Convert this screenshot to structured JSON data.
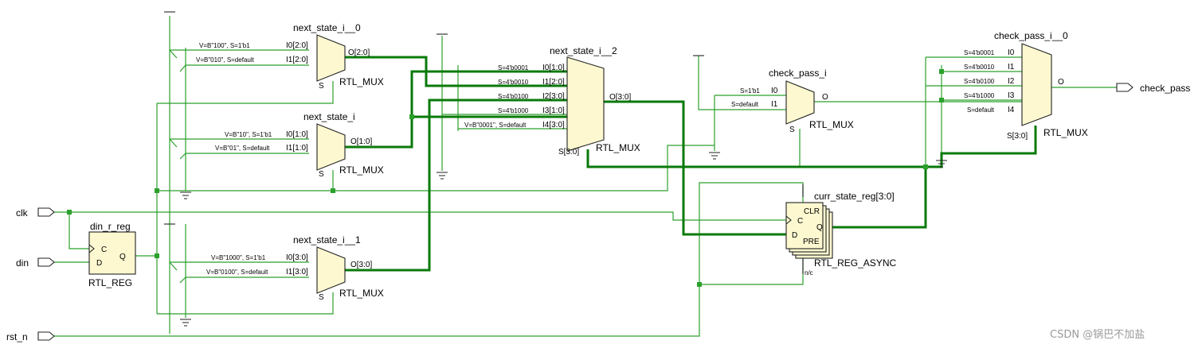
{
  "ports": {
    "clk": "clk",
    "din": "din",
    "rst_n": "rst_n",
    "check_pass": "check_pass"
  },
  "din_r_reg": {
    "name": "din_r_reg",
    "type": "RTL_REG",
    "pin_c": "C",
    "pin_d": "D",
    "pin_q": "Q"
  },
  "next_state_i__0": {
    "name": "next_state_i__0",
    "type": "RTL_MUX",
    "in0_const": "V=B\"100\", S=1'b1",
    "in0_pin": "I0[2:0]",
    "in1_const": "V=B\"010\", S=default",
    "in1_pin": "I1[2:0]",
    "out_pin": "O[2:0]",
    "sel_pin": "S"
  },
  "next_state_i": {
    "name": "next_state_i",
    "type": "RTL_MUX",
    "in0_const": "V=B\"10\", S=1'b1",
    "in0_pin": "I0[1:0]",
    "in1_const": "V=B\"01\", S=default",
    "in1_pin": "I1[1:0]",
    "out_pin": "O[1:0]",
    "sel_pin": "S"
  },
  "next_state_i__1": {
    "name": "next_state_i__1",
    "type": "RTL_MUX",
    "in0_const": "V=B\"1000\", S=1'b1",
    "in0_pin": "I0[3:0]",
    "in1_const": "V=B\"0100\", S=default",
    "in1_pin": "I1[3:0]",
    "out_pin": "O[3:0]",
    "sel_pin": "S"
  },
  "next_state_i__2": {
    "name": "next_state_i__2",
    "type": "RTL_MUX",
    "inputs": [
      {
        "cond": "S=4'b0001",
        "pin": "I0[1:0]"
      },
      {
        "cond": "S=4'b0010",
        "pin": "I1[2:0]"
      },
      {
        "cond": "S=4'b0100",
        "pin": "I2[3:0]"
      },
      {
        "cond": "S=4'b1000",
        "pin": "I3[1:0]"
      },
      {
        "cond": "V=B\"0001\", S=default",
        "pin": "I4[3:0]"
      }
    ],
    "out_pin": "O[3:0]",
    "sel_pin": "S[3:0]"
  },
  "check_pass_i": {
    "name": "check_pass_i",
    "type": "RTL_MUX",
    "inputs": [
      {
        "cond": "S=1'b1",
        "pin": "I0"
      },
      {
        "cond": "S=default",
        "pin": "I1"
      }
    ],
    "out_pin": "O",
    "sel_pin": "S"
  },
  "check_pass_i__0": {
    "name": "check_pass_i__0",
    "type": "RTL_MUX",
    "inputs": [
      {
        "cond": "S=4'b0001",
        "pin": "I0"
      },
      {
        "cond": "S=4'b0010",
        "pin": "I1"
      },
      {
        "cond": "S=4'b0100",
        "pin": "I2"
      },
      {
        "cond": "S=4'b1000",
        "pin": "I3"
      },
      {
        "cond": "S=default",
        "pin": "I4"
      }
    ],
    "out_pin": "O",
    "sel_pin": "S[3:0]"
  },
  "curr_state_reg": {
    "name": "curr_state_reg[3:0]",
    "type": "RTL_REG_ASYNC",
    "pin_clr": "CLR",
    "pin_c": "C",
    "pin_d": "D",
    "pin_q": "Q",
    "pin_pre": "PRE",
    "nc": "n/c"
  },
  "watermark": "CSDN @锅巴不加盐",
  "colors": {
    "wire": "#2ca02c",
    "bus": "#0a7a0a",
    "block_fill": "#fdf8d0",
    "outline": "#222222"
  }
}
